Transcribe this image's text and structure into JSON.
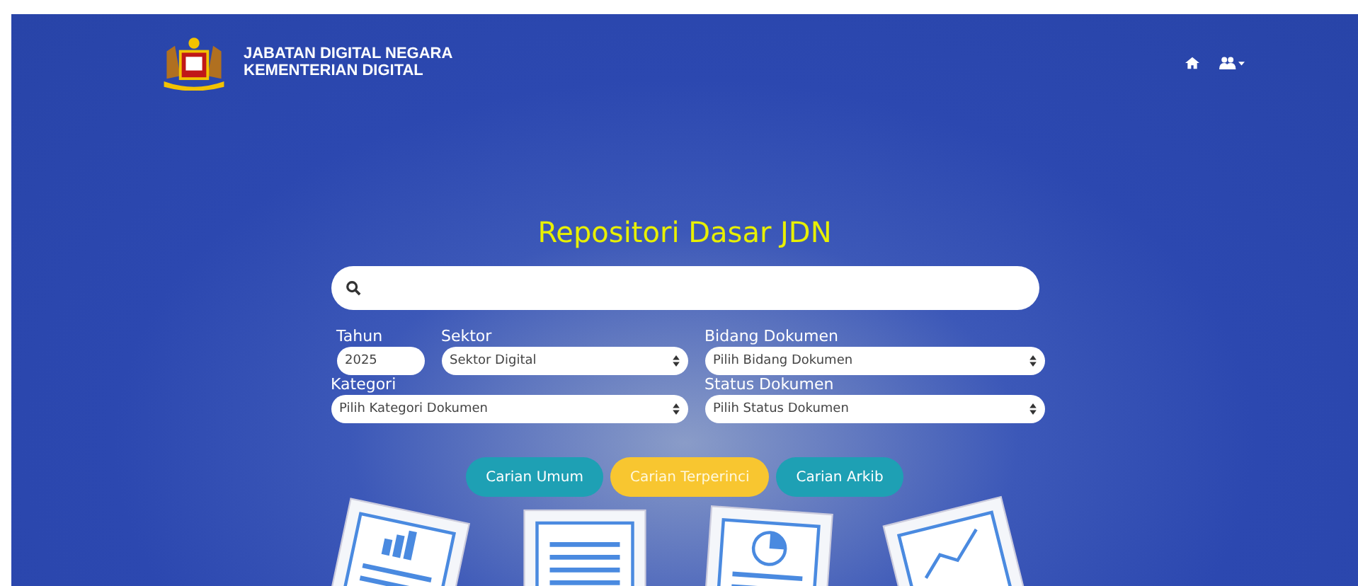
{
  "header": {
    "org_line_1": "JABATAN DIGITAL NEGARA",
    "org_line_2": "KEMENTERIAN DIGITAL"
  },
  "title": "Repositori Dasar JDN",
  "filters": [
    {
      "label": "Tahun",
      "value": "2025",
      "kind": "input"
    },
    {
      "label": "Sektor",
      "value": "Sektor Digital",
      "kind": "select"
    },
    {
      "label": "Bidang Dokumen",
      "value": "Pilih Bidang Dokumen",
      "kind": "select"
    },
    {
      "label": "Kategori",
      "value": "Pilih Kategori Dokumen",
      "kind": "select"
    },
    {
      "label": "Status Dokumen",
      "value": "Pilih Status Dokumen",
      "kind": "select"
    }
  ],
  "search_tabs": [
    {
      "label": "Carian Umum",
      "selected": false
    },
    {
      "label": "Carian Terperinci",
      "selected": true
    },
    {
      "label": "Carian Arkib",
      "selected": false
    }
  ]
}
